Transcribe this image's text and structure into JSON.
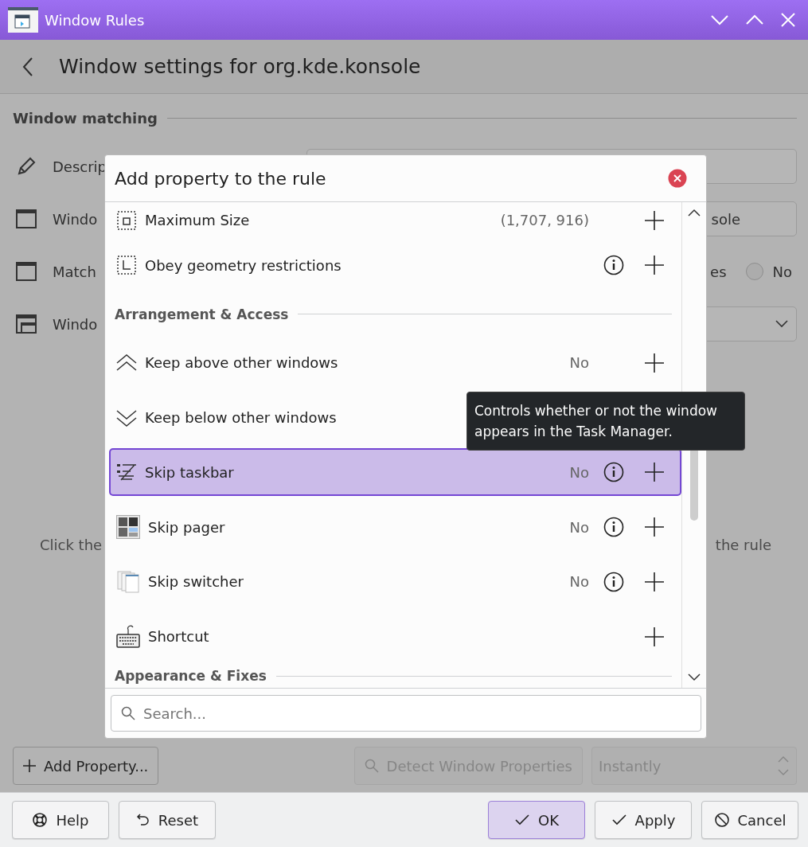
{
  "window": {
    "title": "Window Rules"
  },
  "header": {
    "title": "Window settings for org.kde.konsole"
  },
  "matching": {
    "title": "Window matching",
    "rows": [
      {
        "label": "Descrip"
      },
      {
        "label": "Windo"
      },
      {
        "label": "Match"
      },
      {
        "label": "Windo"
      }
    ],
    "controls": [
      {
        "kind": "field"
      },
      {
        "kind": "field",
        "value": "sole"
      },
      {
        "kind": "radio",
        "partial_label": "es",
        "option": {
          "label": "No",
          "selected": false
        }
      },
      {
        "kind": "dropdown"
      }
    ]
  },
  "hint": {
    "left": "Click the",
    "right": "the rule"
  },
  "footer": {
    "add_button": "Add Property...",
    "detect_button": {
      "label": "Detect Window Properties",
      "disabled": true
    },
    "delay": {
      "value": "Instantly",
      "disabled": true
    }
  },
  "buttons": [
    {
      "kind": "help",
      "label": "Help",
      "default": false
    },
    {
      "kind": "reset",
      "label": "Reset",
      "default": false
    },
    {
      "kind": "ok",
      "label": "OK",
      "default": true
    },
    {
      "kind": "apply",
      "label": "Apply",
      "default": false
    },
    {
      "kind": "cancel",
      "label": "Cancel",
      "default": false
    }
  ],
  "dialog": {
    "title": "Add property to the rule",
    "items": [
      {
        "kind": "property",
        "label": "Maximum Size",
        "value": "(1,707, 916)",
        "info": false,
        "add": true,
        "selected": false
      },
      {
        "kind": "property",
        "label": "Obey geometry restrictions",
        "info": true,
        "add": true,
        "selected": false
      },
      {
        "kind": "section",
        "label": "Arrangement & Access"
      },
      {
        "kind": "property",
        "label": "Keep above other windows",
        "value": "No",
        "info": false,
        "add": true,
        "selected": false
      },
      {
        "kind": "property",
        "label": "Keep below other windows",
        "selected": false
      },
      {
        "kind": "property",
        "label": "Skip taskbar",
        "value": "No",
        "info": true,
        "add": true,
        "selected": true
      },
      {
        "kind": "property",
        "label": "Skip pager",
        "value": "No",
        "info": true,
        "add": true,
        "selected": false
      },
      {
        "kind": "property",
        "label": "Skip switcher",
        "value": "No",
        "info": true,
        "add": true,
        "selected": false
      },
      {
        "kind": "property",
        "label": "Shortcut",
        "info": false,
        "add": true,
        "selected": false
      },
      {
        "kind": "section",
        "label": "Appearance & Fixes"
      }
    ],
    "search": {
      "placeholder": "Search..."
    }
  },
  "tooltip": {
    "text": "Controls whether or not the window appears in the Task Manager."
  }
}
